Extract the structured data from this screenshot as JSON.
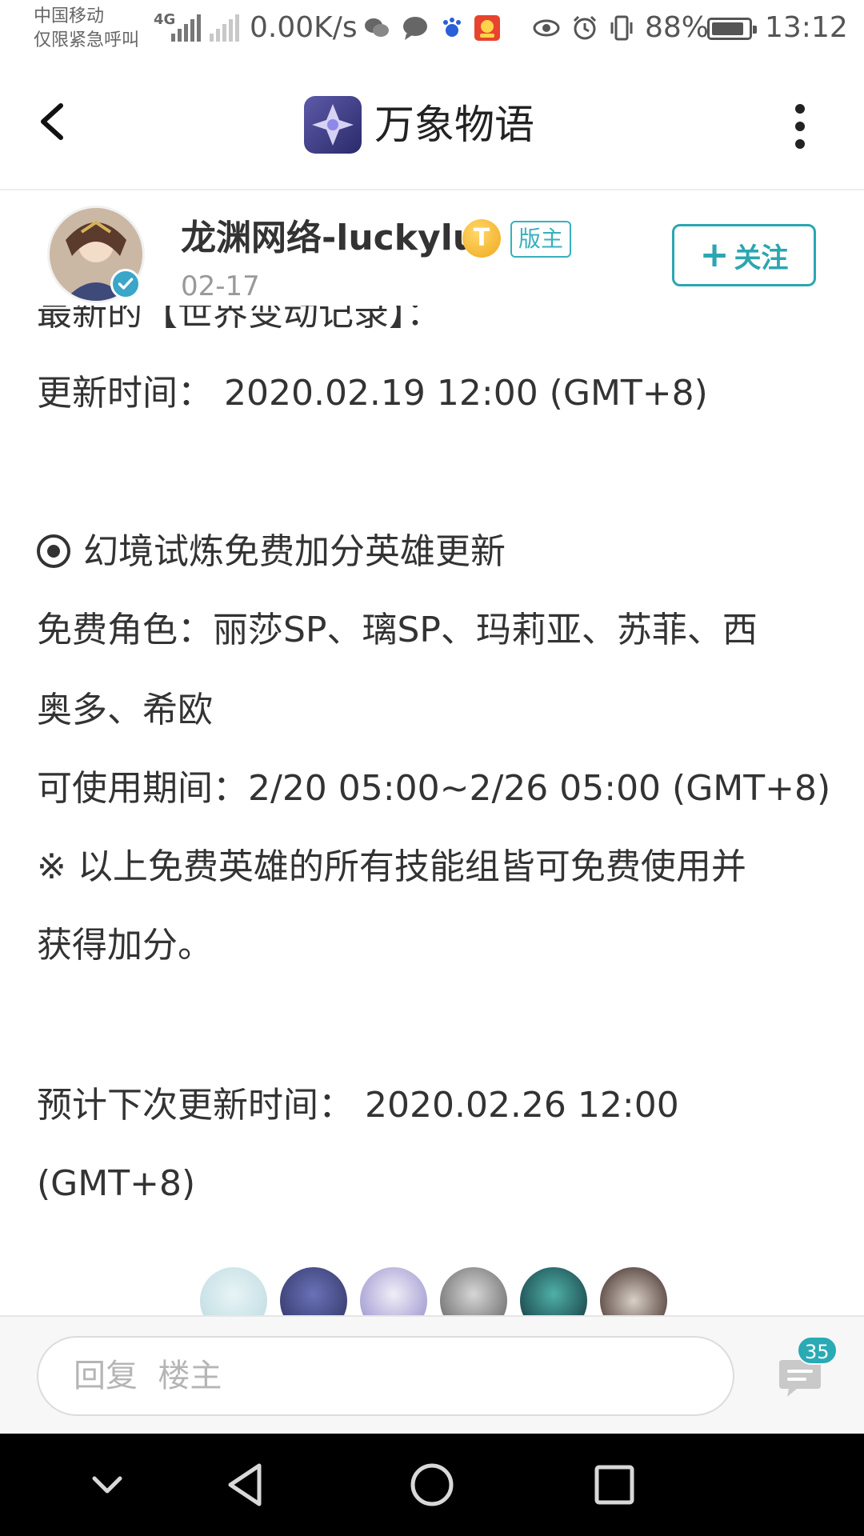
{
  "status_bar": {
    "carrier_line1": "中国移动",
    "carrier_line2": "仅限紧急呼叫",
    "network": "4G",
    "speed": "0.00K/s",
    "battery": "88%",
    "battery_level": 0.88,
    "time": "13:12"
  },
  "header": {
    "title": "万象物语"
  },
  "author": {
    "name": "龙渊网络-luckylu",
    "level_badge": "T",
    "role_badge": "版主",
    "date": "02-17",
    "follow_label": "关注",
    "follow_plus": "+"
  },
  "post": {
    "cut_line": "最新的【世界变动记录】：",
    "update_time": "更新时间： 2020.02.19 12:00 (GMT+8)",
    "section_title": "幻境试炼免费加分英雄更新",
    "free_roles_1": "免费角色：丽莎SP、璃SP、玛莉亚、苏菲、西",
    "free_roles_2": "奥多、希欧",
    "period": "可使用期间：2/20 05:00~2/26 05:00 (GMT+8)",
    "note_1": "※ 以上免费英雄的所有技能组皆可免费使用并",
    "note_2": "获得加分。",
    "next_update_1": "预计下次更新时间： 2020.02.26 12:00",
    "next_update_2": "(GMT+8)"
  },
  "reply": {
    "placeholder": "回复  楼主",
    "comment_count": "35"
  },
  "colors": {
    "accent": "#2ca6b1",
    "badge_gold": "#f0a81b",
    "nav_bg": "#000000"
  },
  "icons": {
    "back": "chevron-left-icon",
    "more": "more-vertical-icon",
    "comments": "chat-bubble-icon",
    "nav": [
      "chevron-down-icon",
      "back-triangle-icon",
      "home-circle-icon",
      "recents-square-icon"
    ]
  }
}
